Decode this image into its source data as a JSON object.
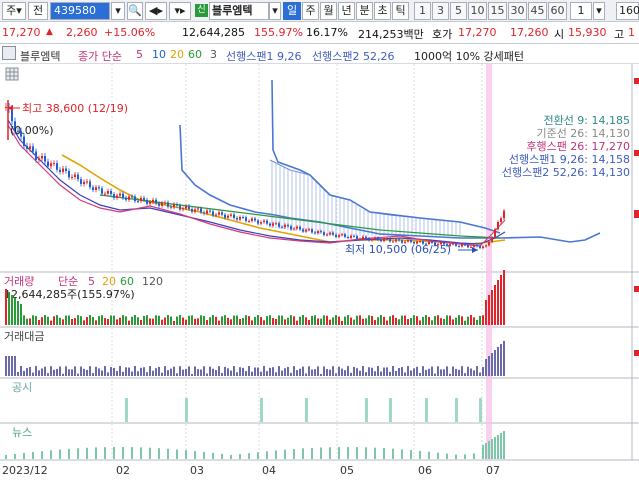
{
  "toolbar": {
    "market": "주",
    "type_label": "전",
    "code": "439580",
    "new_badge": "신",
    "stock_name": "블루엠텍",
    "periods": [
      "일",
      "주",
      "월",
      "년",
      "분",
      "초",
      "틱"
    ],
    "selected_period": "일",
    "intervals": [
      "1",
      "3",
      "5",
      "10",
      "15",
      "30",
      "45",
      "60",
      "1"
    ],
    "count": "160"
  },
  "quote": {
    "price": "17,270",
    "change": "2,260",
    "change_pct": "+15.06%",
    "volume": "12,644,285",
    "volume_ratio": "155.97%",
    "turnover": "16.17%",
    "amount": "214,253백만",
    "bid_label": "호가",
    "bid": "17,270",
    "ask": "17,260",
    "open_label": "시",
    "open": "15,930",
    "high_label": "고",
    "high": "1"
  },
  "legend": {
    "name": "블루엠텍",
    "ma_label": "종가 단순",
    "ma_periods": [
      "5",
      "10",
      "20",
      "60",
      "3"
    ],
    "span1": "선행스팬1 9,26",
    "span2": "선행스팬2 52,26",
    "extra": "1000억 10% 강세패턴"
  },
  "colors": {
    "up": "#e0242a",
    "down": "#1f5fd1",
    "ma5": "#d43b7a",
    "ma20": "#e0a400",
    "ma60": "#2a9a3a",
    "span1": "#5b7fd1",
    "span2": "#4a77d4",
    "highlight": "#ff9bd8"
  },
  "chart_data": {
    "type": "candlestick",
    "annotations": {
      "high": "최고 38,600 (12/19)",
      "low": "최저 10,500 (06/25)",
      "pct": "(0.00%)"
    },
    "ichimoku_labels": [
      "전환선 9: 14,185",
      "기준선 26: 14,130",
      "후행스팬 26: 17,270",
      "선행스팬1 9,26: 14,158",
      "선행스팬2 52,26: 14,130"
    ],
    "volume_legend": {
      "label": "거래량",
      "ma_label": "단순",
      "periods": [
        "5",
        "20",
        "60",
        "120"
      ],
      "value": "12,644,285주(155.97%)"
    },
    "panels": [
      "거래대금",
      "공시",
      "뉴스"
    ],
    "x_labels": [
      "2023/12",
      "02",
      "03",
      "04",
      "05",
      "06",
      "07"
    ],
    "price_path": [
      [
        0,
        36000
      ],
      [
        5,
        30000
      ],
      [
        10,
        27000
      ],
      [
        15,
        25500
      ],
      [
        20,
        24000
      ],
      [
        25,
        22500
      ],
      [
        30,
        21000
      ],
      [
        35,
        20000
      ],
      [
        40,
        19500
      ],
      [
        45,
        19000
      ],
      [
        50,
        18500
      ],
      [
        55,
        18000
      ],
      [
        60,
        17500
      ],
      [
        65,
        17000
      ],
      [
        70,
        16500
      ],
      [
        75,
        16000
      ],
      [
        80,
        15500
      ],
      [
        85,
        15000
      ],
      [
        90,
        14500
      ],
      [
        95,
        14000
      ],
      [
        100,
        13500
      ],
      [
        105,
        13000
      ],
      [
        110,
        12600
      ],
      [
        115,
        12300
      ],
      [
        120,
        12000
      ],
      [
        125,
        11800
      ],
      [
        130,
        11600
      ],
      [
        135,
        11400
      ],
      [
        140,
        11200
      ],
      [
        145,
        11000
      ],
      [
        150,
        10800
      ],
      [
        155,
        10600
      ],
      [
        160,
        10500
      ],
      [
        163,
        13500
      ],
      [
        166,
        17270
      ]
    ]
  }
}
